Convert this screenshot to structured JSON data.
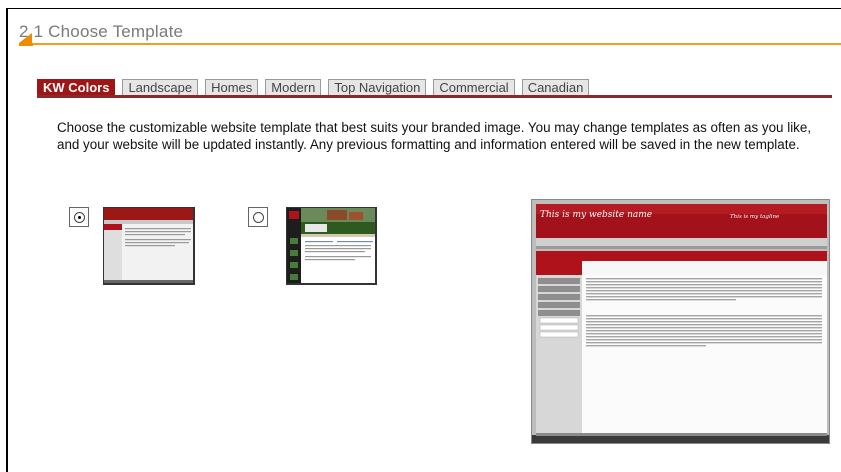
{
  "section": {
    "title": "2.1 Choose Template",
    "accent_color": "#f08a00"
  },
  "tabs": [
    {
      "label": "KW Colors",
      "active": true
    },
    {
      "label": "Landscape",
      "active": false
    },
    {
      "label": "Homes",
      "active": false
    },
    {
      "label": "Modern",
      "active": false
    },
    {
      "label": "Top Navigation",
      "active": false
    },
    {
      "label": "Commercial",
      "active": false
    },
    {
      "label": "Canadian",
      "active": false
    }
  ],
  "active_tab_color": "#9e1717",
  "description": "Choose the customizable website template that best suits your branded image. You may change templates as often as you like, and your website will be updated instantly. Any previous formatting and information entered will be saved in the new template.",
  "templates": [
    {
      "selected": true,
      "icon": "template-red-thumbnail"
    },
    {
      "selected": false,
      "icon": "template-homes-thumbnail"
    }
  ],
  "preview": {
    "site_name": "This is my website name",
    "tagline": "This is my tagline",
    "brand_color": "#b0121c"
  }
}
